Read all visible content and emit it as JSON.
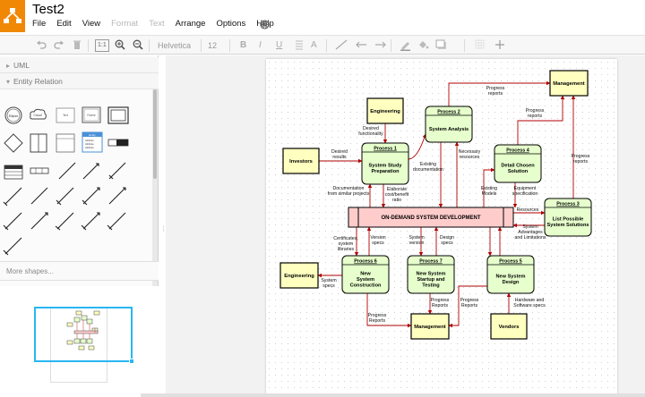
{
  "app": {
    "title": "Test2"
  },
  "menu": [
    {
      "label": "File",
      "disabled": false
    },
    {
      "label": "Edit",
      "disabled": false
    },
    {
      "label": "View",
      "disabled": false
    },
    {
      "label": "Format",
      "disabled": true
    },
    {
      "label": "Text",
      "disabled": true
    },
    {
      "label": "Arrange",
      "disabled": false
    },
    {
      "label": "Options",
      "disabled": false
    },
    {
      "label": "Help",
      "disabled": false
    }
  ],
  "toolbar": {
    "zoom_actual_label": "1:1",
    "font_name": "Helvetica",
    "font_size": "12"
  },
  "sidebar": {
    "sections": [
      {
        "label": "UML",
        "caret": "▸"
      },
      {
        "label": "Entity Relation",
        "caret": "▾"
      }
    ],
    "more_shapes": "More shapes...",
    "palette_labels": {
      "circle": "Ellipse",
      "cloud": "Cloud",
      "textbox": "Text",
      "frame": "Frame",
      "list_title": "Entity",
      "attr": "Attribute"
    }
  },
  "colors": {
    "brand": "#f08705",
    "process_fill": "#e6ffcc",
    "external_fill": "#ffffc0",
    "system_fill": "#ffcccc",
    "flow": "#b20000",
    "selection": "#29b6f2"
  },
  "diagram": {
    "externals": {
      "engineering_top": "Engineering",
      "investors": "Investors",
      "management_top": "Management",
      "engineering_left": "Engineering",
      "management_bottom": "Management",
      "vendors": "Vendors"
    },
    "processes": {
      "p1": {
        "id": "Process 1",
        "name": [
          "System Study",
          "Preparation"
        ]
      },
      "p2": {
        "id": "Process 2",
        "name": [
          "System Analysis"
        ]
      },
      "p3": {
        "id": "Process 3",
        "name": [
          "List Possible",
          "System Solutions"
        ]
      },
      "p4": {
        "id": "Process 4",
        "name": [
          "Detail Chosen",
          "Solution"
        ]
      },
      "p5": {
        "id": "Process 5",
        "name": [
          "New System",
          "Design"
        ]
      },
      "p6": {
        "id": "Process 6",
        "name": [
          "New",
          "System",
          "Construction"
        ]
      },
      "p7": {
        "id": "Process 7",
        "name": [
          "New System",
          "Startup and",
          "Testing"
        ]
      }
    },
    "system": "ON-DEMAND SYSTEM DEVELOPMENT",
    "labels": {
      "progress_reports_top": [
        "Progress",
        "reports"
      ],
      "progress_reports_p4": [
        "Progress",
        "reports"
      ],
      "progress_reports_p3": [
        "Progress",
        "reports"
      ],
      "desired_functionality": [
        "Desired",
        "functionality"
      ],
      "desired_results": [
        "Desired",
        "results"
      ],
      "existing_documentation": [
        "Existing",
        "documentation"
      ],
      "necessary_resources": [
        "Necessary",
        "resources"
      ],
      "documentation": [
        "Documentation",
        "from similar projects"
      ],
      "elaborate": [
        "Elaborate",
        "cost/benefit",
        "ratio"
      ],
      "existing_models": [
        "Existing",
        "Models"
      ],
      "equipment_spec": [
        "Equipment",
        "specification"
      ],
      "resources": [
        "Resources"
      ],
      "system_advantages": [
        "System",
        "Advantages",
        "and Limitations"
      ],
      "certificates": [
        "Certificates,",
        "system",
        "libraries"
      ],
      "version_specs": [
        "Version",
        "specs"
      ],
      "system_version": [
        "System",
        "version"
      ],
      "design_specs": [
        "Design",
        "specs"
      ],
      "system_specs": [
        "System",
        "specs"
      ],
      "progress_reports_p6": [
        "Progress",
        "Reports"
      ],
      "progress_reports_p7": [
        "Progress",
        "Reports"
      ],
      "progress_reports_p5": [
        "Progress",
        "Reports"
      ],
      "hardware_specs": [
        "Hardware and",
        "Software specs"
      ]
    }
  }
}
